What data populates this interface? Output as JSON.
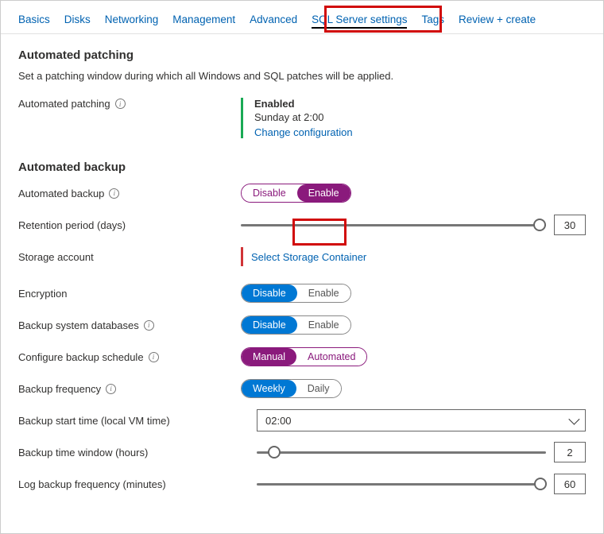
{
  "tabs": {
    "basics": "Basics",
    "disks": "Disks",
    "networking": "Networking",
    "management": "Management",
    "advanced": "Advanced",
    "sql": "SQL Server settings",
    "tags": "Tags",
    "review": "Review + create"
  },
  "patching": {
    "heading": "Automated patching",
    "desc": "Set a patching window during which all Windows and SQL patches will be applied.",
    "label": "Automated patching",
    "status": "Enabled",
    "schedule": "Sunday at 2:00",
    "change": "Change configuration"
  },
  "backup": {
    "heading": "Automated backup",
    "automated_label": "Automated backup",
    "disable": "Disable",
    "enable": "Enable",
    "retention_label": "Retention period (days)",
    "retention_value": "30",
    "storage_label": "Storage account",
    "storage_link": "Select Storage Container",
    "encryption_label": "Encryption",
    "sysdb_label": "Backup system databases",
    "schedule_label": "Configure backup schedule",
    "manual": "Manual",
    "automated": "Automated",
    "frequency_label": "Backup frequency",
    "weekly": "Weekly",
    "daily": "Daily",
    "start_label": "Backup start time (local VM time)",
    "start_value": "02:00",
    "window_label": "Backup time window (hours)",
    "window_value": "2",
    "log_label": "Log backup frequency (minutes)",
    "log_value": "60"
  }
}
